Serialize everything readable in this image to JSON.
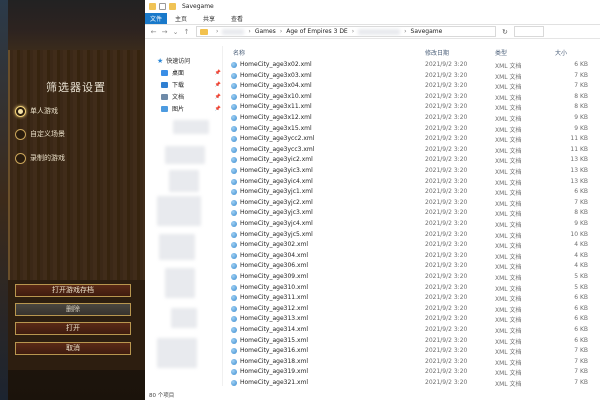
{
  "game": {
    "filter_title": "筛选器设置",
    "radios": [
      {
        "label": "单人游戏",
        "selected": true
      },
      {
        "label": "自定义场景",
        "selected": false
      },
      {
        "label": "录制的游戏",
        "selected": false
      }
    ],
    "buttons": {
      "open_save": "打开游戏存档",
      "delete": "删除",
      "open": "打开",
      "cancel": "取消"
    }
  },
  "explorer": {
    "window_title": "Savegame",
    "ribbon": {
      "file": "文件",
      "home": "主页",
      "share": "共享",
      "view": "查看"
    },
    "address": {
      "segments": [
        "Games",
        "Age of Empires 3 DE",
        "Savegame"
      ]
    },
    "sidebar": {
      "quick_access": "快速访问",
      "items": [
        {
          "label": "桌面",
          "icon": "desktop-icon",
          "color": "#3a8ee6"
        },
        {
          "label": "下载",
          "icon": "download-icon",
          "color": "#2f7fd1"
        },
        {
          "label": "文档",
          "icon": "documents-icon",
          "color": "#6e8aa8"
        },
        {
          "label": "图片",
          "icon": "pictures-icon",
          "color": "#4d9be0"
        }
      ]
    },
    "columns": {
      "name": "名称",
      "date": "修改日期",
      "type": "类型",
      "size": "大小"
    },
    "files": [
      {
        "name": "HomeCity_age3x02.xml",
        "date": "2021/9/2 3:20",
        "type": "XML 文档",
        "size": "6 KB"
      },
      {
        "name": "HomeCity_age3x03.xml",
        "date": "2021/9/2 3:20",
        "type": "XML 文档",
        "size": "7 KB"
      },
      {
        "name": "HomeCity_age3x04.xml",
        "date": "2021/9/2 3:20",
        "type": "XML 文档",
        "size": "7 KB"
      },
      {
        "name": "HomeCity_age3x10.xml",
        "date": "2021/9/2 3:20",
        "type": "XML 文档",
        "size": "8 KB"
      },
      {
        "name": "HomeCity_age3x11.xml",
        "date": "2021/9/2 3:20",
        "type": "XML 文档",
        "size": "8 KB"
      },
      {
        "name": "HomeCity_age3x12.xml",
        "date": "2021/9/2 3:20",
        "type": "XML 文档",
        "size": "9 KB"
      },
      {
        "name": "HomeCity_age3x15.xml",
        "date": "2021/9/2 3:20",
        "type": "XML 文档",
        "size": "9 KB"
      },
      {
        "name": "HomeCity_age3ycc2.xml",
        "date": "2021/9/2 3:20",
        "type": "XML 文档",
        "size": "11 KB"
      },
      {
        "name": "HomeCity_age3ycc3.xml",
        "date": "2021/9/2 3:20",
        "type": "XML 文档",
        "size": "11 KB"
      },
      {
        "name": "HomeCity_age3yic2.xml",
        "date": "2021/9/2 3:20",
        "type": "XML 文档",
        "size": "13 KB"
      },
      {
        "name": "HomeCity_age3yic3.xml",
        "date": "2021/9/2 3:20",
        "type": "XML 文档",
        "size": "13 KB"
      },
      {
        "name": "HomeCity_age3yic4.xml",
        "date": "2021/9/2 3:20",
        "type": "XML 文档",
        "size": "13 KB"
      },
      {
        "name": "HomeCity_age3yjc1.xml",
        "date": "2021/9/2 3:20",
        "type": "XML 文档",
        "size": "6 KB"
      },
      {
        "name": "HomeCity_age3yjc2.xml",
        "date": "2021/9/2 3:20",
        "type": "XML 文档",
        "size": "7 KB"
      },
      {
        "name": "HomeCity_age3yjc3.xml",
        "date": "2021/9/2 3:20",
        "type": "XML 文档",
        "size": "8 KB"
      },
      {
        "name": "HomeCity_age3yjc4.xml",
        "date": "2021/9/2 3:20",
        "type": "XML 文档",
        "size": "9 KB"
      },
      {
        "name": "HomeCity_age3yjc5.xml",
        "date": "2021/9/2 3:20",
        "type": "XML 文档",
        "size": "10 KB"
      },
      {
        "name": "HomeCity_age302.xml",
        "date": "2021/9/2 3:20",
        "type": "XML 文档",
        "size": "4 KB"
      },
      {
        "name": "HomeCity_age304.xml",
        "date": "2021/9/2 3:20",
        "type": "XML 文档",
        "size": "4 KB"
      },
      {
        "name": "HomeCity_age306.xml",
        "date": "2021/9/2 3:20",
        "type": "XML 文档",
        "size": "4 KB"
      },
      {
        "name": "HomeCity_age309.xml",
        "date": "2021/9/2 3:20",
        "type": "XML 文档",
        "size": "5 KB"
      },
      {
        "name": "HomeCity_age310.xml",
        "date": "2021/9/2 3:20",
        "type": "XML 文档",
        "size": "5 KB"
      },
      {
        "name": "HomeCity_age311.xml",
        "date": "2021/9/2 3:20",
        "type": "XML 文档",
        "size": "6 KB"
      },
      {
        "name": "HomeCity_age312.xml",
        "date": "2021/9/2 3:20",
        "type": "XML 文档",
        "size": "6 KB"
      },
      {
        "name": "HomeCity_age313.xml",
        "date": "2021/9/2 3:20",
        "type": "XML 文档",
        "size": "6 KB"
      },
      {
        "name": "HomeCity_age314.xml",
        "date": "2021/9/2 3:20",
        "type": "XML 文档",
        "size": "6 KB"
      },
      {
        "name": "HomeCity_age315.xml",
        "date": "2021/9/2 3:20",
        "type": "XML 文档",
        "size": "6 KB"
      },
      {
        "name": "HomeCity_age316.xml",
        "date": "2021/9/2 3:20",
        "type": "XML 文档",
        "size": "7 KB"
      },
      {
        "name": "HomeCity_age318.xml",
        "date": "2021/9/2 3:20",
        "type": "XML 文档",
        "size": "7 KB"
      },
      {
        "name": "HomeCity_age319.xml",
        "date": "2021/9/2 3:20",
        "type": "XML 文档",
        "size": "7 KB"
      },
      {
        "name": "HomeCity_age321.xml",
        "date": "2021/9/2 3:20",
        "type": "XML 文档",
        "size": "7 KB"
      }
    ],
    "status": "80 个项目"
  }
}
